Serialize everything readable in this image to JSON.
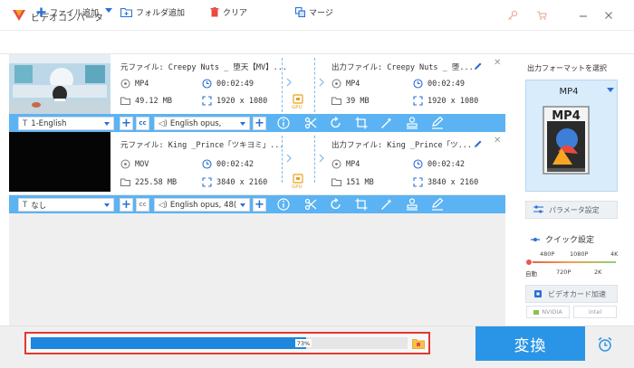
{
  "window": {
    "title": "ビデオコンバータ",
    "controls": [
      "key-icon",
      "cart-icon",
      "minimize-icon",
      "close-icon"
    ]
  },
  "toolbar": {
    "add_file": "ファイル追加",
    "add_folder": "フォルダ追加",
    "clear": "クリア",
    "merge": "マージ"
  },
  "files": [
    {
      "source_name": "元ファイル: Creepy Nuts _ 堕天【MV】...",
      "source_format": "MP4",
      "source_duration": "00:02:49",
      "source_size": "49.12 MB",
      "source_resolution": "1920 x 1080",
      "output_name": "出力ファイル: Creepy Nuts _ 堕...",
      "output_format": "MP4",
      "output_duration": "00:02:49",
      "output_size": "39 MB",
      "output_resolution": "1920 x 1080",
      "gpu_label": "GPU",
      "subtitle": "1-English",
      "audio": "English opus,"
    },
    {
      "source_name": "元ファイル: King _Prince「ツキヨミ」...",
      "source_format": "MOV",
      "source_duration": "00:02:42",
      "source_size": "225.58 MB",
      "source_resolution": "3840 x 2160",
      "output_name": "出力ファイル: King _Prince「ツ...",
      "output_format": "MP4",
      "output_duration": "00:02:42",
      "output_size": "151 MB",
      "output_resolution": "3840 x 2160",
      "gpu_label": "GPU",
      "subtitle": "なし",
      "audio": "English opus, 48("
    }
  ],
  "panel": {
    "output_label": "出力フォーマットを選択",
    "format": "MP4",
    "format_icon_text": "MP4",
    "param_button": "パラメータ設定",
    "quick_label": "クイック設定",
    "quick_ticks_top": [
      "480P",
      "1080P",
      "4K"
    ],
    "quick_ticks_bottom": [
      "自動",
      "720P",
      "2K"
    ],
    "gpu_button": "ビデオカード加速",
    "vendors": [
      "NVIDIA",
      "intel"
    ]
  },
  "progress": {
    "percent_text": "73%",
    "value": 0.73
  },
  "convert_button": "変換",
  "colors": {
    "accent": "#2a95e6",
    "bar": "#5bb3f3",
    "progress_fill": "#1d86de",
    "highlight_border": "#e0392f"
  }
}
